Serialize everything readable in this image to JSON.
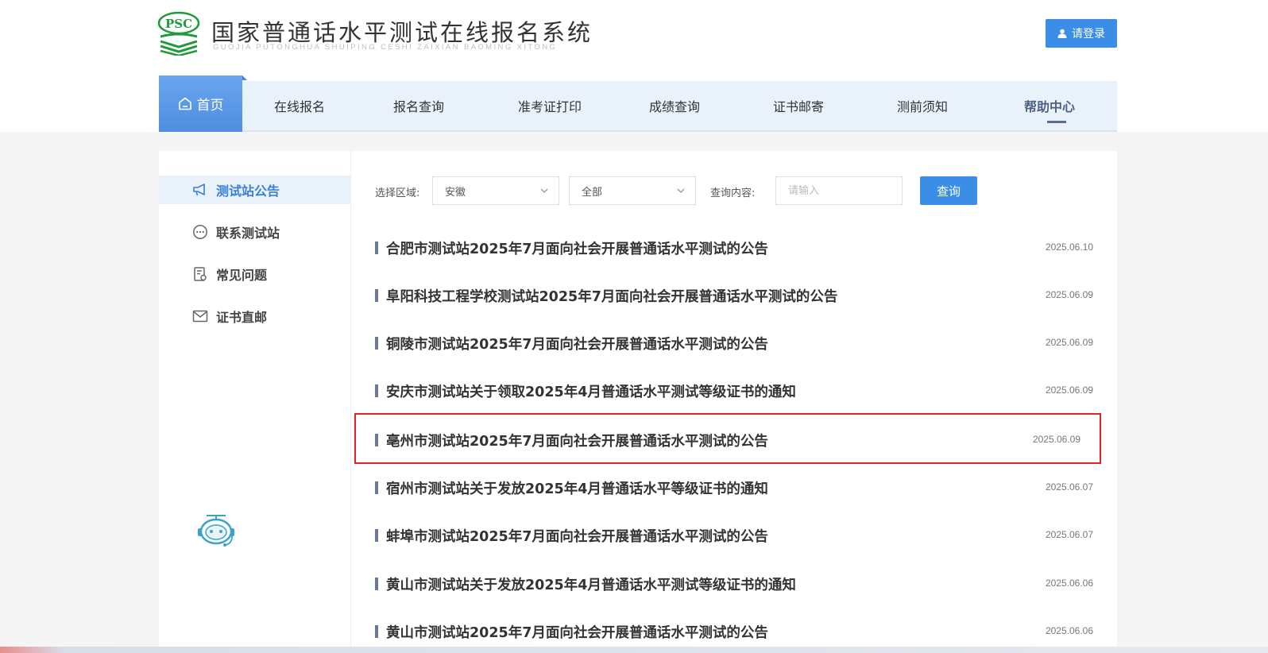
{
  "header": {
    "logo_mark_text": "PSC",
    "title": "国家普通话水平测试在线报名系统",
    "subtitle": "GUOJIA PUTONGHUA SHUIPING CESHI ZAIXIAN BAOMING XITONG",
    "login_label": "请登录"
  },
  "nav": {
    "home": "首页",
    "items": [
      "在线报名",
      "报名查询",
      "准考证打印",
      "成绩查询",
      "证书邮寄",
      "测前须知",
      "帮助中心"
    ]
  },
  "sidebar": {
    "items": [
      {
        "label": "测试站公告",
        "icon": "megaphone-icon"
      },
      {
        "label": "联系测试站",
        "icon": "chat-icon"
      },
      {
        "label": "常见问题",
        "icon": "faq-icon"
      },
      {
        "label": "证书直邮",
        "icon": "mail-icon"
      }
    ],
    "active_index": 0
  },
  "filter": {
    "region_label": "选择区域:",
    "region_value": "安徽",
    "category_value": "全部",
    "query_label": "查询内容:",
    "query_placeholder": "请输入",
    "query_button": "查询"
  },
  "news": [
    {
      "title": "合肥市测试站2025年7月面向社会开展普通话水平测试的公告",
      "date": "2025.06.10"
    },
    {
      "title": "阜阳科技工程学校测试站2025年7月面向社会开展普通话水平测试的公告",
      "date": "2025.06.09"
    },
    {
      "title": "铜陵市测试站2025年7月面向社会开展普通话水平测试的公告",
      "date": "2025.06.09"
    },
    {
      "title": "安庆市测试站关于领取2025年4月普通话水平测试等级证书的通知",
      "date": "2025.06.09"
    },
    {
      "title": "亳州市测试站2025年7月面向社会开展普通话水平测试的公告",
      "date": "2025.06.09"
    },
    {
      "title": "宿州市测试站关于发放2025年4月普通话水平等级证书的通知",
      "date": "2025.06.07"
    },
    {
      "title": "蚌埠市测试站2025年7月面向社会开展普通话水平测试的公告",
      "date": "2025.06.07"
    },
    {
      "title": "黄山市测试站关于发放2025年4月普通话水平测试等级证书的通知",
      "date": "2025.06.06"
    },
    {
      "title": "黄山市测试站2025年7月面向社会开展普通话水平测试的公告",
      "date": "2025.06.06"
    }
  ],
  "colors": {
    "primary": "#3a8ee6",
    "nav_bg": "#e9f1fb",
    "highlight_border": "#e0232b",
    "logo_green": "#1f9a3b"
  }
}
